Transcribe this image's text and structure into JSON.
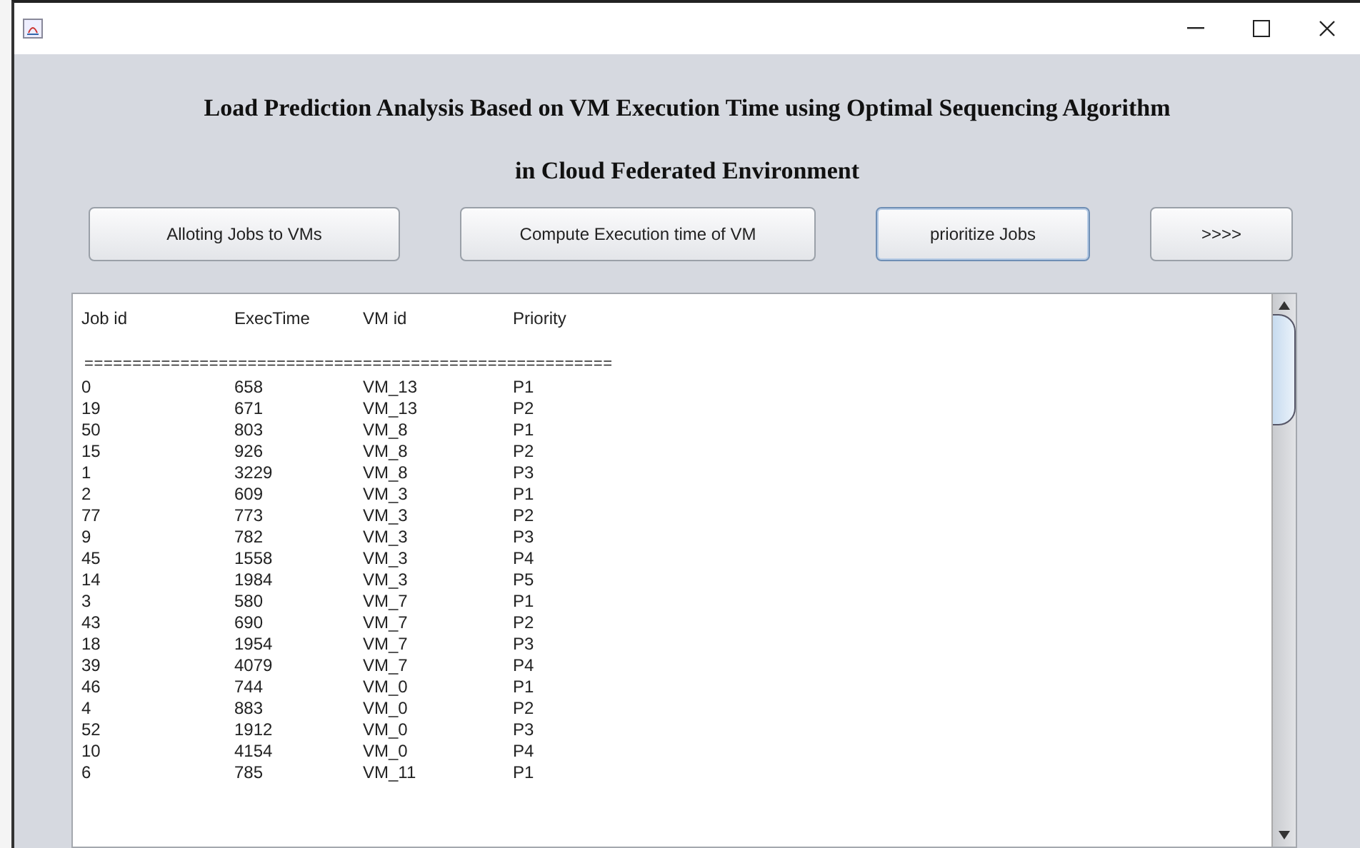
{
  "window": {
    "title_lines": [
      "Load Prediction Analysis Based on VM Execution Time using Optimal Sequencing Algorithm",
      "in Cloud Federated Environment"
    ]
  },
  "buttons": [
    {
      "label": "Alloting Jobs to VMs",
      "focused": false
    },
    {
      "label": "Compute Execution time of VM",
      "focused": false
    },
    {
      "label": "prioritize Jobs",
      "focused": true
    },
    {
      "label": ">>>>",
      "focused": false
    }
  ],
  "output": {
    "columns": [
      "Job id",
      "ExecTime",
      "VM id",
      "Priority"
    ],
    "separator": "=======================================================",
    "rows": [
      [
        "0",
        "658",
        "VM_13",
        "P1"
      ],
      [
        "19",
        "671",
        "VM_13",
        "P2"
      ],
      [
        "50",
        "803",
        "VM_8",
        "P1"
      ],
      [
        "15",
        "926",
        "VM_8",
        "P2"
      ],
      [
        "1",
        "3229",
        "VM_8",
        "P3"
      ],
      [
        "2",
        "609",
        "VM_3",
        "P1"
      ],
      [
        "77",
        "773",
        "VM_3",
        "P2"
      ],
      [
        "9",
        "782",
        "VM_3",
        "P3"
      ],
      [
        "45",
        "1558",
        "VM_3",
        "P4"
      ],
      [
        "14",
        "1984",
        "VM_3",
        "P5"
      ],
      [
        "3",
        "580",
        "VM_7",
        "P1"
      ],
      [
        "43",
        "690",
        "VM_7",
        "P2"
      ],
      [
        "18",
        "1954",
        "VM_7",
        "P3"
      ],
      [
        "39",
        "4079",
        "VM_7",
        "P4"
      ],
      [
        "46",
        "744",
        "VM_0",
        "P1"
      ],
      [
        "4",
        "883",
        "VM_0",
        "P2"
      ],
      [
        "52",
        "1912",
        "VM_0",
        "P3"
      ],
      [
        "10",
        "4154",
        "VM_0",
        "P4"
      ],
      [
        "6",
        "785",
        "VM_11",
        "P1"
      ]
    ]
  }
}
